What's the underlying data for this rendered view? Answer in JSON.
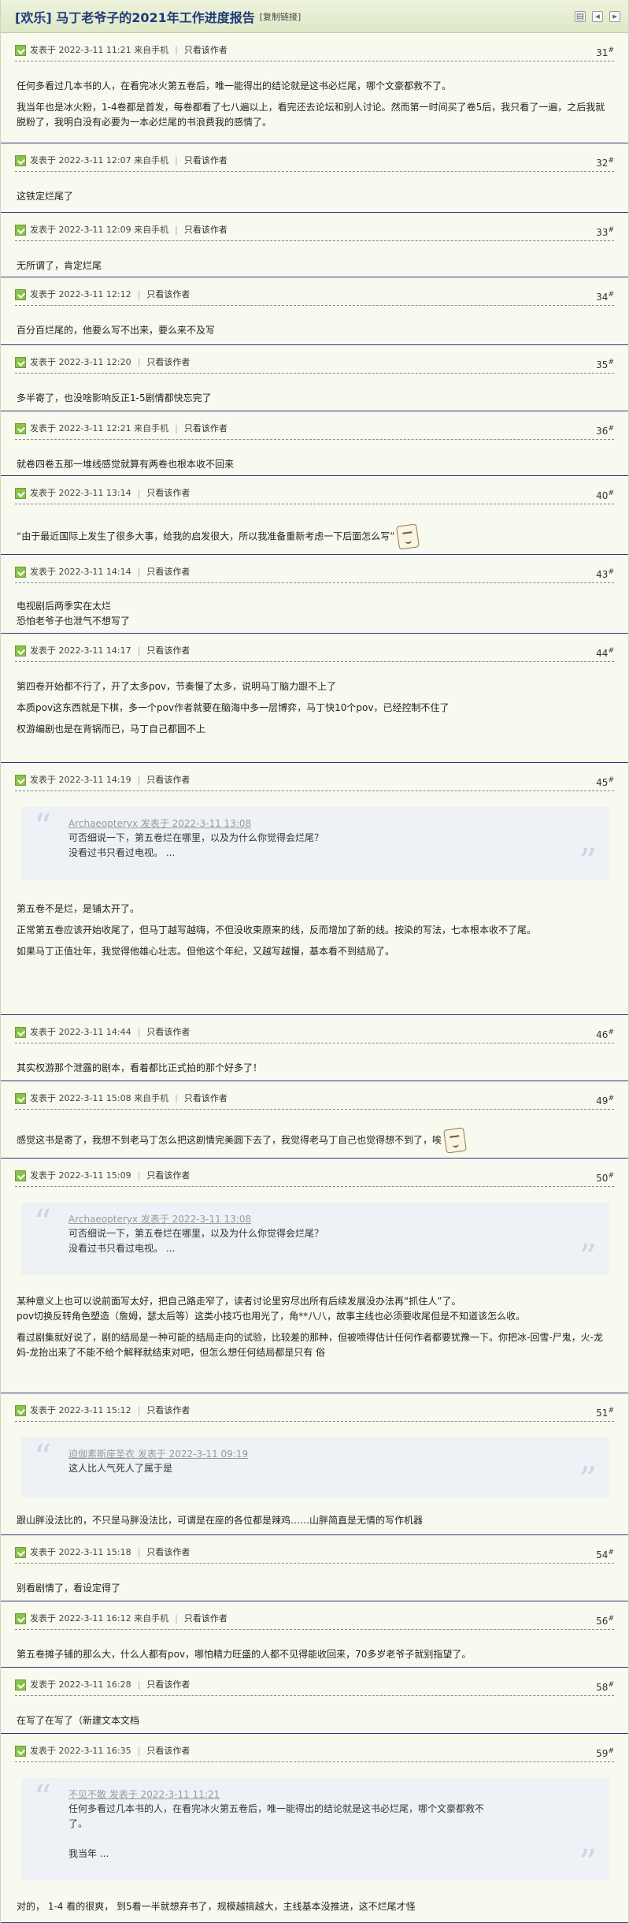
{
  "header": {
    "title": "[欢乐] 马丁老爷子的2021年工作进度报告",
    "copy_link": "[复制链接]",
    "icons": [
      "print-icon",
      "prev-icon",
      "next-icon"
    ]
  },
  "only_author": "只看该作者",
  "quote_open": "“",
  "quote_close": "”",
  "posts": [
    {
      "meta": "发表于 2022-3-11 11:21 来自手机",
      "floor": "31",
      "lines": [
        "任何多看过几本书的人，在看完冰火第五卷后，唯一能得出的结论就是这书必烂尾，哪个文豪都救不了。",
        "",
        "我当年也是冰火粉，1-4卷都是首发，每卷都看了七八遍以上，看完还去论坛和别人讨论。然而第一时间买了卷5后，我只看了一遍，之后我就脱粉了，我明白没有必要为一本必烂尾的书浪费我的感情了。"
      ]
    },
    {
      "meta": "发表于 2022-3-11 12:07 来自手机",
      "floor": "32",
      "lines": [
        "这铁定烂尾了"
      ]
    },
    {
      "meta": "发表于 2022-3-11 12:09 来自手机",
      "floor": "33",
      "lines": [
        "无所谓了，肯定烂尾"
      ]
    },
    {
      "meta": "发表于 2022-3-11 12:12",
      "floor": "34",
      "lines": [
        "百分百烂尾的，他要么写不出来，要么来不及写"
      ]
    },
    {
      "meta": "发表于 2022-3-11 12:20",
      "floor": "35",
      "lines": [
        "多半寄了，也没啥影响反正1-5剧情都快忘完了"
      ]
    },
    {
      "meta": "发表于 2022-3-11 12:21 来自手机",
      "floor": "36",
      "lines": [
        "就卷四卷五那一堆线感觉就算有两卷也根本收不回来"
      ]
    },
    {
      "meta": "发表于 2022-3-11 13:14",
      "floor": "40",
      "lines": [
        "“由于最近国际上发生了很多大事，给我的启发很大，所以我准备重新考虑一下后面怎么写”"
      ]
    },
    {
      "meta": "发表于 2022-3-11 14:14",
      "floor": "43",
      "lines": [
        "电视剧后两季实在太烂",
        "恐怕老爷子也泄气不想写了"
      ]
    },
    {
      "meta": "发表于 2022-3-11 14:17",
      "floor": "44",
      "lines": [
        "第四卷开始都不行了，开了太多pov，节奏慢了太多，说明马丁脑力跟不上了",
        "",
        "本质pov这东西就是下棋，多一个pov作者就要在脑海中多一层博弈，马丁快10个pov，已经控制不住了",
        "",
        "权游编剧也是在背锅而已，马丁自己都圆不上"
      ]
    },
    {
      "meta": "发表于 2022-3-11 14:19",
      "floor": "45",
      "quote": {
        "head": "Archaeopteryx 发表于 2022-3-11 13:08",
        "lines": [
          "可否细说一下，第五卷烂在哪里，以及为什么你觉得会烂尾？",
          "没看过书只看过电视。 ..."
        ]
      },
      "lines": [
        "第五卷不是烂，是铺太开了。",
        "",
        "正常第五卷应该开始收尾了，但马丁越写越嗨，不但没收束原来的线，反而增加了新的线。按染的写法，七本根本收不了尾。",
        "",
        "如果马丁正值壮年，我觉得他雄心壮志。但他这个年纪，又越写越慢，基本看不到结局了。"
      ]
    },
    {
      "meta": "发表于 2022-3-11 14:44",
      "floor": "46",
      "lines": [
        "其实权游那个泄露的剧本，看着都比正式拍的那个好多了！"
      ]
    },
    {
      "meta": "发表于 2022-3-11 15:08 来自手机",
      "floor": "49",
      "lines": [
        "感觉这书是寄了，我想不到老马丁怎么把这剧情完美圆下去了，我觉得老马丁自己也觉得想不到了，唉"
      ]
    },
    {
      "meta": "发表于 2022-3-11 15:09",
      "floor": "50",
      "quote": {
        "head": "Archaeopteryx 发表于 2022-3-11 13:08",
        "lines": [
          "可否细说一下，第五卷烂在哪里，以及为什么你觉得会烂尾？",
          "没看过书只看过电视。 ..."
        ]
      },
      "lines": [
        "某种意义上也可以说前面写太好，把自己路走窄了，读者讨论里穷尽出所有后续发展没办法再“抓住人”了。",
        "pov切换反转角色塑造（詹姆，瑟太后等）这类小技巧也用光了，角**八八，故事主线也必须要收尾但是不知道该怎么收。",
        "",
        "看过剧集就好说了，剧的结局是一种可能的结局走向的试验，比较差的那种，但被喷得估计任何作者都要犹豫一下。你把冰-回雪-尸鬼，火-龙妈-龙抬出来了不能不给个解释就结束对吧，但怎么想任何结局都是只有 俗"
      ]
    },
    {
      "meta": "发表于 2022-3-11 15:12",
      "floor": "51",
      "quote": {
        "head": "迫伽素斯座圣衣 发表于 2022-3-11 09:19",
        "lines": [
          "这人比人气死人了属于是"
        ]
      },
      "lines": [
        "跟山胖没法比的，不只是马胖没法比，可谓是在座的各位都是辣鸡……山胖简直是无情的写作机器"
      ]
    },
    {
      "meta": "发表于 2022-3-11 15:18",
      "floor": "54",
      "lines": [
        "别看剧情了，看设定得了"
      ]
    },
    {
      "meta": "发表于 2022-3-11 16:12 来自手机",
      "floor": "56",
      "lines": [
        "第五卷摊子铺的那么大，什么人都有pov，哪怕精力旺盛的人都不见得能收回来，70多岁老爷子就别指望了。"
      ]
    },
    {
      "meta": "发表于 2022-3-11 16:28",
      "floor": "58",
      "lines": [
        "在写了在写了（新建文本文档"
      ]
    },
    {
      "meta": "发表于 2022-3-11 16:35",
      "floor": "59",
      "quote": {
        "head": "不见不散 发表于 2022-3-11 11:21",
        "lines": [
          "任何多看过几本书的人，在看完冰火第五卷后，唯一能得出的结论就是这书必烂尾，哪个文豪都救不",
          "了。",
          "",
          "我当年 ..."
        ]
      },
      "lines": [
        "对的， 1-4 看的很爽， 到5看一半就想弃书了，规模越搞越大，主线基本没推进，这不烂尾才怪"
      ]
    }
  ]
}
